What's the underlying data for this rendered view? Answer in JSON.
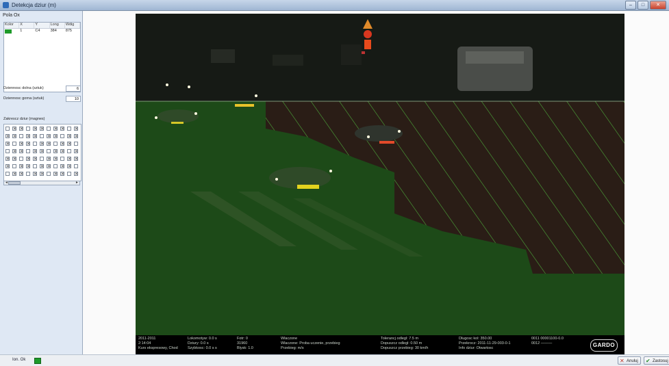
{
  "window": {
    "title": "Detekcja dziur (m)",
    "controls": {
      "minimize": "–",
      "maximize": "□",
      "close": "✕"
    }
  },
  "left_panel": {
    "heading": "Pola Ox",
    "detections_table": {
      "columns": [
        "Kolor",
        "X",
        "Y",
        "Long",
        "Wdig"
      ],
      "rows": [
        {
          "color": "#1e9a2a",
          "x": "1",
          "y": "C4",
          "long": "384",
          "wdig": "875"
        }
      ]
    },
    "params": [
      {
        "label": "Dziennosc dolna (sztuk)",
        "value": "6"
      },
      {
        "label": "Dziennosc  gorna (sztuk)",
        "value": "10"
      }
    ],
    "grid_label": "Zakrescz dziur (magnes)"
  },
  "camera": {
    "info_bar": {
      "col1": [
        "2011-2011",
        "2:14:04",
        "Kurs ekspresowy, Chod"
      ],
      "col2": [
        "Lokomotyw: 0.0   s",
        "Dziury: 0.0   s",
        "Szybkosc: 0.0  s   s"
      ],
      "col3": [
        "Fotr:  0",
        "31960",
        "Blysk: 1.0"
      ],
      "col4": [
        "Wlaczone",
        "Wlaczone: Proba uczenie, przebieg",
        "Przebieg:       m/s"
      ],
      "col5": [
        "Tolerancj odlegl: 7.5   m",
        "Dopuszcz odlegl: 0.50  m",
        "Dopuszcz przebieg: 30   km/h"
      ],
      "col6": [
        "Dlugosc kol: 350.00",
        "Przekrocz: 2011-11-29-003-0-1",
        "Info dziur: Otwartosc"
      ],
      "col7": [
        "0011   00001100-0.0",
        "0012   ———"
      ],
      "logo": "GARDO"
    }
  },
  "statusbar": {
    "left_text": "Ion. Ok",
    "buttons": [
      {
        "label": "Anuluj",
        "icon": "✕",
        "color": "#c0392b"
      },
      {
        "label": "Zastosuj",
        "icon": "✔",
        "color": "#2a8f2a"
      }
    ]
  }
}
